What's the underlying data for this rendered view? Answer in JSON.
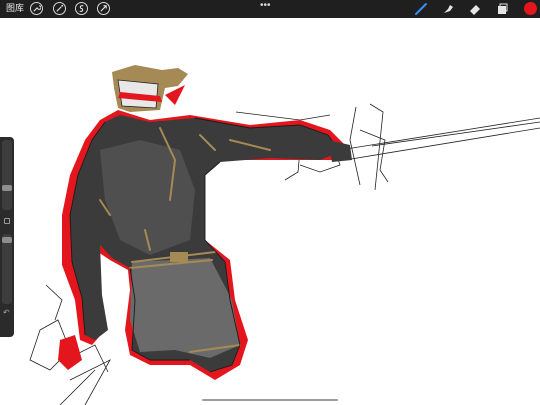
{
  "topbar": {
    "gallery_label": "图库",
    "more_label": "•••",
    "left_tools": [
      {
        "name": "wrench-icon"
      },
      {
        "name": "magic-wand-icon"
      },
      {
        "name": "selection-icon"
      },
      {
        "name": "transform-arrow-icon"
      }
    ],
    "right_tools": [
      {
        "name": "brush-icon"
      },
      {
        "name": "smudge-icon"
      },
      {
        "name": "eraser-icon"
      },
      {
        "name": "layers-icon"
      }
    ],
    "active_color": "#e3161d"
  },
  "sidebar": {
    "brush_size_level": 0.65,
    "opacity_level": 0.95,
    "undo_icon": "undo-icon"
  },
  "colors": {
    "topbar_bg": "#1f1f1f",
    "armor_dark": "#3b3b3b",
    "accent_red": "#e3161d",
    "gold": "#a58a55"
  }
}
